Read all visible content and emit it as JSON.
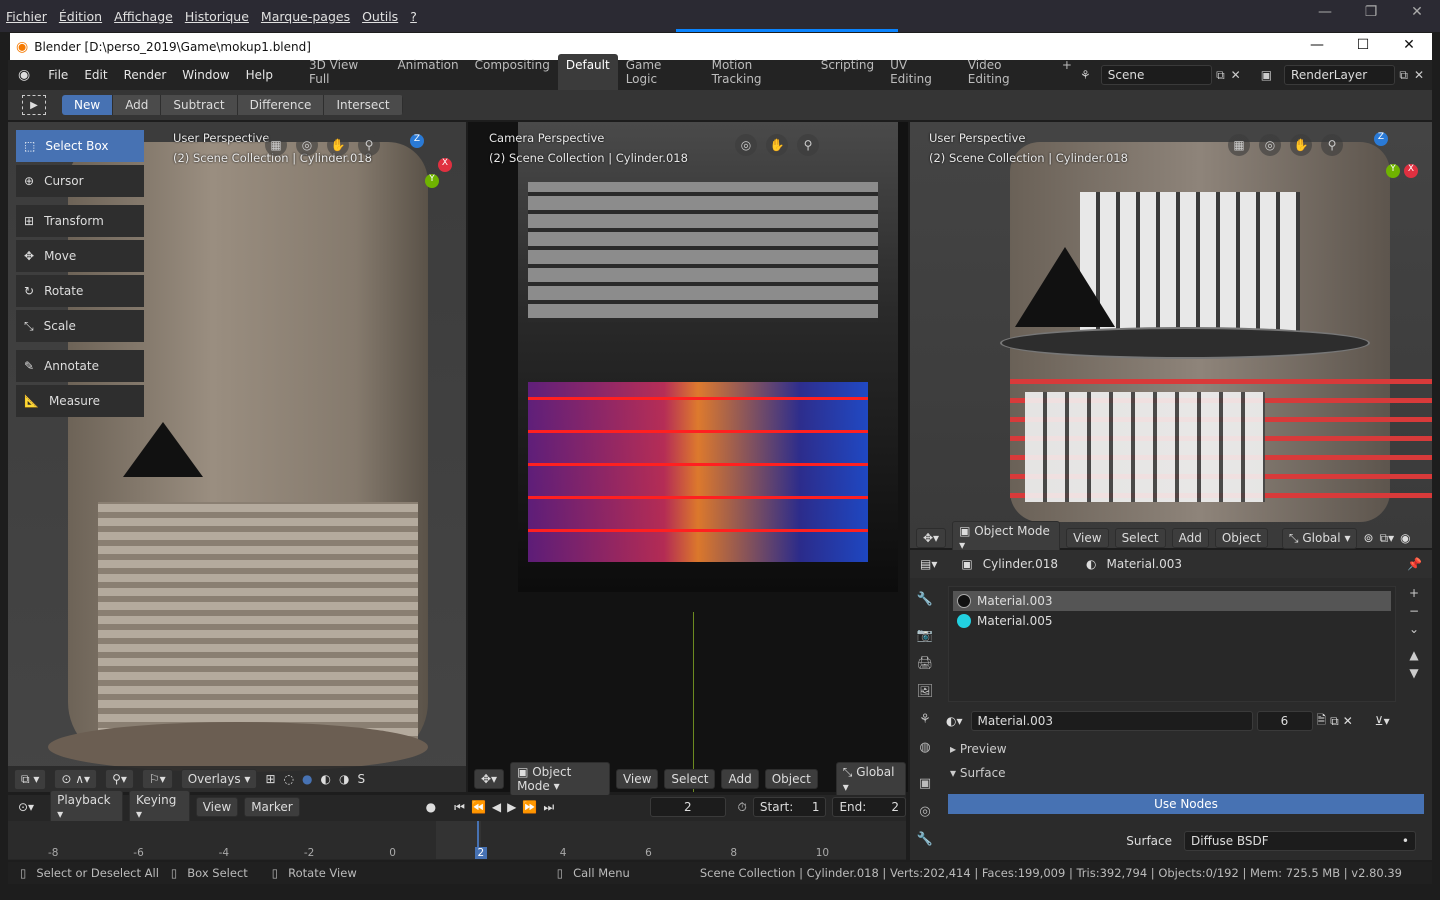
{
  "firefox": {
    "menus": [
      "Fichier",
      "Édition",
      "Affichage",
      "Historique",
      "Marque-pages",
      "Outils",
      "?"
    ]
  },
  "window": {
    "title": "Blender [D:\\perso_2019\\Game\\mokup1.blend]"
  },
  "topbar": {
    "menus": [
      "File",
      "Edit",
      "Render",
      "Window",
      "Help"
    ],
    "workspaces": [
      "3D View Full",
      "Animation",
      "Compositing",
      "Default",
      "Game Logic",
      "Motion Tracking",
      "Scripting",
      "UV Editing",
      "Video Editing"
    ],
    "active_workspace": "Default",
    "scene": "Scene",
    "render_layer": "RenderLayer"
  },
  "toolheader": {
    "modes": [
      "New",
      "Add",
      "Subtract",
      "Difference",
      "Intersect"
    ],
    "active": "New"
  },
  "toolbar": {
    "items": [
      "Select Box",
      "Cursor",
      "Transform",
      "Move",
      "Rotate",
      "Scale",
      "Annotate",
      "Measure"
    ]
  },
  "viewports": {
    "left": {
      "perspective": "User Perspective",
      "collection": "(2) Scene Collection | Cylinder.018",
      "overlays": "Overlays",
      "trail": "S"
    },
    "center": {
      "perspective": "Camera Perspective",
      "collection": "(2) Scene Collection | Cylinder.018",
      "mode": "Object Mode",
      "view": "View",
      "select": "Select",
      "add": "Add",
      "object": "Object",
      "orientation": "Global"
    },
    "right": {
      "perspective": "User Perspective",
      "collection": "(2) Scene Collection | Cylinder.018",
      "mode": "Object Mode",
      "view": "View",
      "select": "Select",
      "add": "Add",
      "object": "Object",
      "orientation": "Global"
    }
  },
  "gizmo": {
    "z": "Z",
    "x": "X",
    "y": "Y"
  },
  "properties": {
    "object": "Cylinder.018",
    "material": "Material.003",
    "slots": [
      {
        "name": "Material.003",
        "color": "#111111"
      },
      {
        "name": "Material.005",
        "color": "#22d0e0"
      }
    ],
    "material_field": "Material.003",
    "users": "6",
    "preview": "Preview",
    "surface_section": "Surface",
    "use_nodes": "Use Nodes",
    "surface_label": "Surface",
    "surface_value": "Diffuse BSDF"
  },
  "timeline": {
    "playback": "Playback",
    "keying": "Keying",
    "view": "View",
    "marker": "Marker",
    "frame": "2",
    "start_label": "Start:",
    "start": "1",
    "end_label": "End:",
    "end": "2",
    "ticks": [
      "-8",
      "-6",
      "-4",
      "-2",
      "0",
      "2",
      "4",
      "6",
      "8",
      "10"
    ],
    "current": "2"
  },
  "status": {
    "select": "Select or Deselect All",
    "box": "Box Select",
    "rotate": "Rotate View",
    "menu": "Call Menu",
    "info": "Scene Collection | Cylinder.018 | Verts:202,414 | Faces:199,009 | Tris:392,794 | Objects:0/192 | Mem: 725.5 MB | v2.80.39"
  },
  "colors": {
    "accent": "#4772b3",
    "ff_tab": "#0a84ff"
  }
}
